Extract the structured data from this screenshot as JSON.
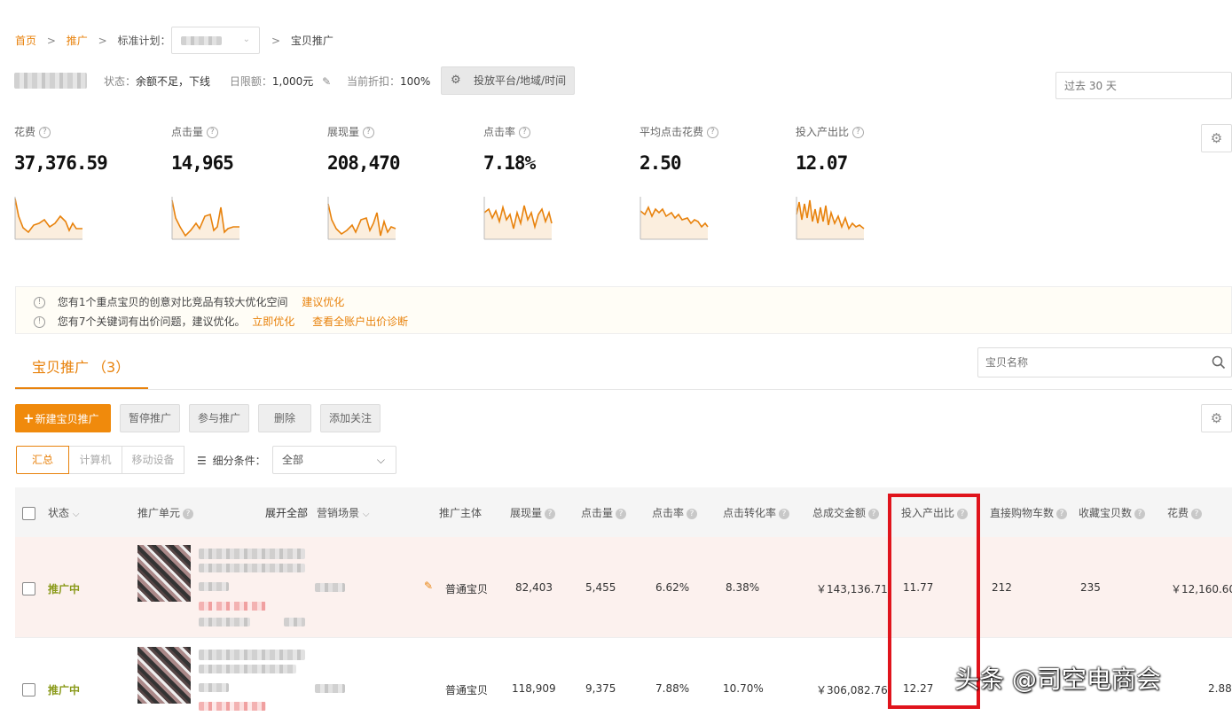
{
  "breadcrumb": {
    "home": "首页",
    "promo": "推广",
    "plan_label": "标准计划：",
    "current": "宝贝推广"
  },
  "status_bar": {
    "status_label": "状态：",
    "status_value": "余额不足，下线",
    "budget_label": "日限额：",
    "budget_value": "1,000元",
    "discount_label": "当前折扣：",
    "discount_value": "100%",
    "platform_button": "投放平台/地域/时间"
  },
  "date_range": {
    "value": "过去 30 天"
  },
  "metrics": [
    {
      "label": "花费",
      "value": "37,376.59"
    },
    {
      "label": "点击量",
      "value": "14,965"
    },
    {
      "label": "展现量",
      "value": "208,470"
    },
    {
      "label": "点击率",
      "value": "7.18%"
    },
    {
      "label": "平均点击花费",
      "value": "2.50"
    },
    {
      "label": "投入产出比",
      "value": "12.07"
    }
  ],
  "notices": [
    {
      "text": "您有1个重点宝贝的创意对比竞品有较大优化空间",
      "links": [
        "建议优化"
      ]
    },
    {
      "text": "您有7个关键词有出价问题，建议优化。",
      "links": [
        "立即优化",
        "查看全账户出价诊断"
      ]
    }
  ],
  "tab": {
    "label": "宝贝推广",
    "count": "（3）"
  },
  "search": {
    "placeholder": "宝贝名称"
  },
  "toolbar": {
    "new_button": "新建宝贝推广",
    "pause": "暂停推广",
    "join": "参与推广",
    "delete": "删除",
    "follow": "添加关注"
  },
  "segment": {
    "all": "汇总",
    "pc": "计算机",
    "mobile": "移动设备",
    "filter_label": "细分条件：",
    "filter_value": "全部"
  },
  "table": {
    "headers": {
      "status": "状态",
      "unit": "推广单元",
      "expand": "展开全部",
      "scene": "营销场景",
      "subject": "推广主体",
      "impressions": "展现量",
      "clicks": "点击量",
      "ctr": "点击率",
      "cvr": "点击转化率",
      "gmv": "总成交金额",
      "roi": "投入产出比",
      "cart": "直接购物车数",
      "fav": "收藏宝贝数",
      "cost": "花费"
    },
    "rows": [
      {
        "status": "推广中",
        "subject": "普通宝贝",
        "impressions": "82,403",
        "clicks": "5,455",
        "ctr": "6.62%",
        "cvr": "8.38%",
        "gmv": "￥143,136.71",
        "roi": "11.77",
        "cart": "212",
        "fav": "235",
        "cost": "￥12,160.60"
      },
      {
        "status": "推广中",
        "subject": "普通宝贝",
        "impressions": "118,909",
        "clicks": "9,375",
        "ctr": "7.88%",
        "cvr": "10.70%",
        "gmv": "￥306,082.76",
        "roi": "12.27",
        "cart": "",
        "fav": "",
        "cost": "2.88"
      }
    ]
  },
  "watermark": "头条 @司空电商会",
  "colors": {
    "accent": "#e8820c",
    "highlight_box": "#e0141c",
    "row_highlight": "#fcf1ee"
  }
}
